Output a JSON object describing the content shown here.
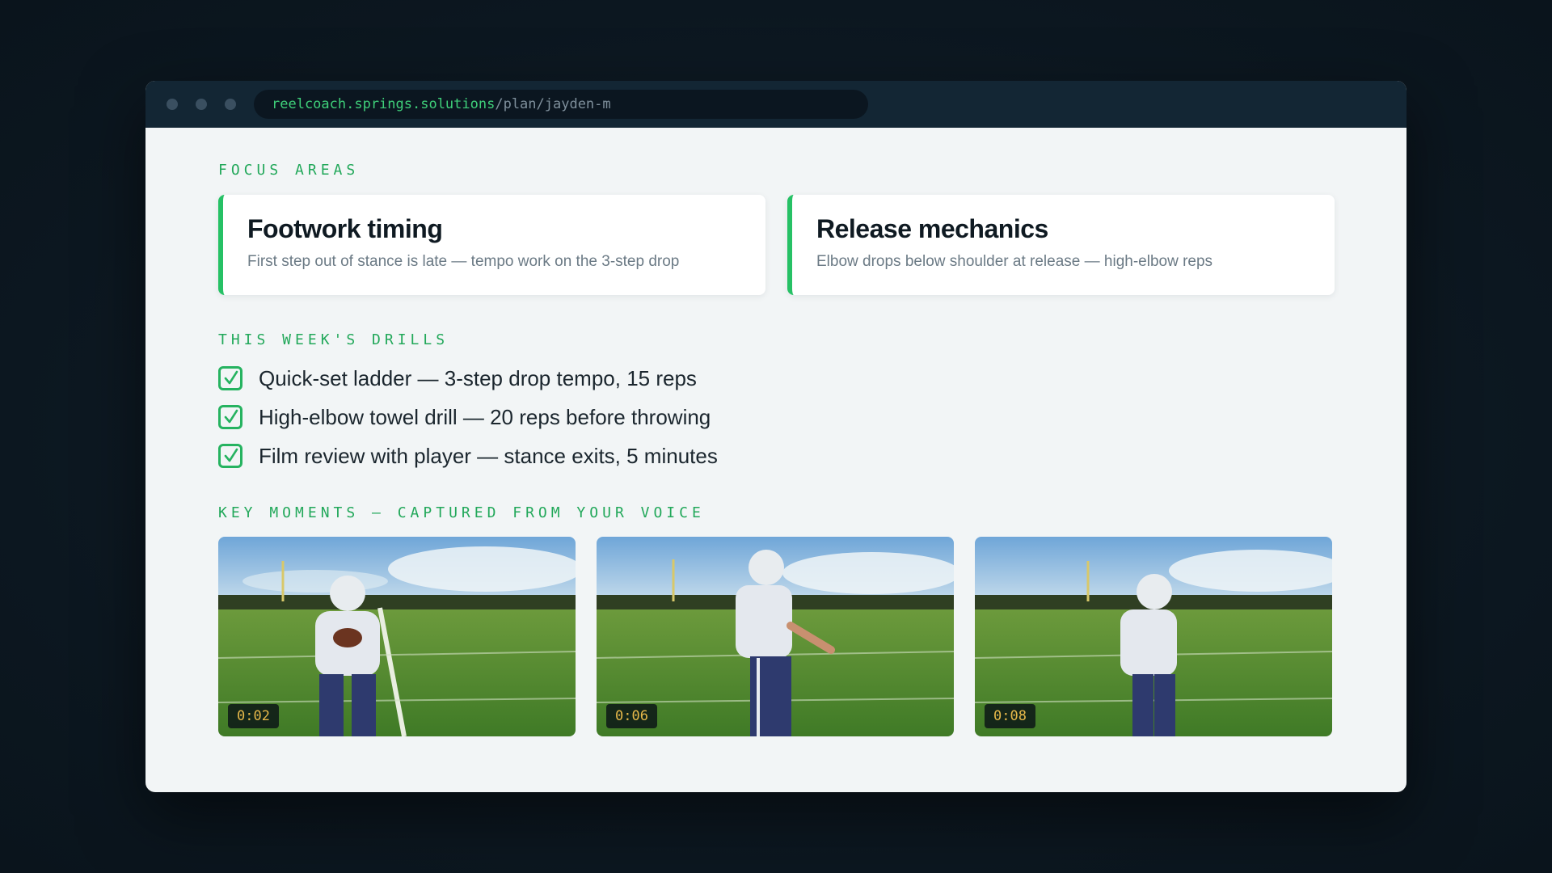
{
  "browser": {
    "url_host": "reelcoach.springs.solutions",
    "url_path": "/plan/jayden-m"
  },
  "focus": {
    "label": "FOCUS AREAS",
    "cards": [
      {
        "title": "Footwork timing",
        "desc": "First step out of stance is late — tempo work on the 3-step drop"
      },
      {
        "title": "Release mechanics",
        "desc": "Elbow drops below shoulder at release — high-elbow reps"
      }
    ]
  },
  "drills": {
    "label": "THIS WEEK'S DRILLS",
    "items": [
      {
        "text": "Quick-set ladder — 3-step drop tempo, 15 reps",
        "checked": true
      },
      {
        "text": "High-elbow towel drill — 20 reps before throwing",
        "checked": true
      },
      {
        "text": "Film review with player — stance exits, 5 minutes",
        "checked": true
      }
    ]
  },
  "moments": {
    "label": "KEY MOMENTS — CAPTURED FROM YOUR VOICE",
    "clips": [
      {
        "timestamp": "0:02"
      },
      {
        "timestamp": "0:06"
      },
      {
        "timestamp": "0:08"
      }
    ]
  },
  "colors": {
    "accent": "#26c165",
    "label_green": "#22a85a",
    "timestamp": "#e6b84a",
    "titlebar": "#132634"
  }
}
